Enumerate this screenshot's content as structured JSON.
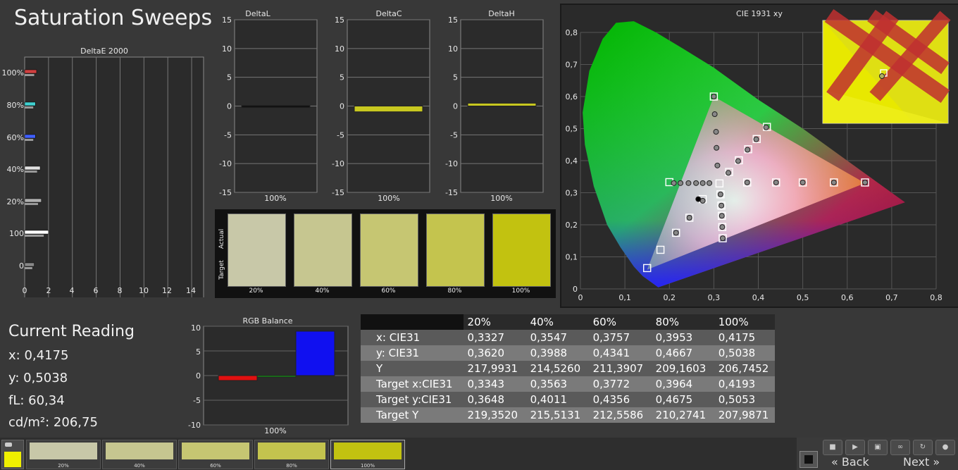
{
  "page_title": "Saturation Sweeps",
  "deltae": {
    "title": "DeltaE 2000",
    "xticks": [
      "0",
      "2",
      "4",
      "6",
      "8",
      "10",
      "12",
      "14"
    ],
    "ylabels": [
      "100%",
      "80%",
      "60%",
      "40%",
      "20%",
      "100",
      "0"
    ]
  },
  "delta_small": [
    {
      "title": "DeltaL",
      "xlabel": "100%"
    },
    {
      "title": "DeltaC",
      "xlabel": "100%"
    },
    {
      "title": "DeltaH",
      "xlabel": "100%"
    }
  ],
  "delta_yticks": [
    "15",
    "10",
    "5",
    "0",
    "-5",
    "-10",
    "-15"
  ],
  "swatch_panel": {
    "actual_label": "Actual",
    "target_label": "Target",
    "items": [
      {
        "label": "20%",
        "color": "#c8c8a8"
      },
      {
        "label": "40%",
        "color": "#c6c690"
      },
      {
        "label": "60%",
        "color": "#c6c672"
      },
      {
        "label": "80%",
        "color": "#c4c44e"
      },
      {
        "label": "100%",
        "color": "#c2c210"
      }
    ]
  },
  "cie": {
    "title": "CIE 1931 xy",
    "xticks": [
      "0",
      "0,1",
      "0,2",
      "0,3",
      "0,4",
      "0,5",
      "0,6",
      "0,7",
      "0,8"
    ],
    "yticks": [
      "0",
      "0,1",
      "0,2",
      "0,3",
      "0,4",
      "0,5",
      "0,6",
      "0,7",
      "0,8"
    ]
  },
  "current_reading": {
    "title": "Current Reading",
    "x": "x: 0,4175",
    "y": "y: 0,5038",
    "fl": "fL: 60,34",
    "cdm2": "cd/m²: 206,75"
  },
  "rgb_balance": {
    "title": "RGB Balance",
    "yticks": [
      "10",
      "5",
      "0",
      "-5",
      "-10"
    ],
    "xlabel": "100%"
  },
  "readings_table": {
    "headers": [
      "",
      "20%",
      "40%",
      "60%",
      "80%",
      "100%"
    ],
    "rows": [
      [
        "x: CIE31",
        "0,3327",
        "0,3547",
        "0,3757",
        "0,3953",
        "0,4175"
      ],
      [
        "y: CIE31",
        "0,3620",
        "0,3988",
        "0,4341",
        "0,4667",
        "0,5038"
      ],
      [
        "Y",
        "217,9931",
        "214,5260",
        "211,3907",
        "209,1603",
        "206,7452"
      ],
      [
        "Target x:CIE31",
        "0,3343",
        "0,3563",
        "0,3772",
        "0,3964",
        "0,4193"
      ],
      [
        "Target y:CIE31",
        "0,3648",
        "0,4011",
        "0,4356",
        "0,4675",
        "0,5053"
      ],
      [
        "Target Y",
        "219,3520",
        "215,5131",
        "212,5586",
        "210,2741",
        "207,9871"
      ]
    ]
  },
  "bottom_bar": {
    "swatches": [
      {
        "label": "20%",
        "color": "#c8c8a8"
      },
      {
        "label": "40%",
        "color": "#c6c690"
      },
      {
        "label": "60%",
        "color": "#c6c672"
      },
      {
        "label": "80%",
        "color": "#c4c44e"
      },
      {
        "label": "100%",
        "color": "#c2c210"
      }
    ],
    "back_label": "Back",
    "next_label": "Next"
  },
  "chart_data": [
    {
      "type": "bar",
      "title": "DeltaE 2000",
      "orientation": "horizontal",
      "categories": [
        "100%",
        "80%",
        "60%",
        "40%",
        "20%",
        "100",
        "0"
      ],
      "values": [
        1.0,
        0.9,
        0.9,
        1.3,
        1.4,
        2.0,
        0.8
      ],
      "xlim": [
        0,
        15
      ]
    },
    {
      "type": "bar",
      "title": "DeltaL",
      "categories": [
        "100%"
      ],
      "values": [
        0.1
      ],
      "ylim": [
        -15,
        15
      ]
    },
    {
      "type": "bar",
      "title": "DeltaC",
      "categories": [
        "100%"
      ],
      "values": [
        -1.0
      ],
      "ylim": [
        -15,
        15
      ]
    },
    {
      "type": "bar",
      "title": "DeltaH",
      "categories": [
        "100%"
      ],
      "values": [
        0.5
      ],
      "ylim": [
        -15,
        15
      ]
    },
    {
      "type": "bar",
      "title": "RGB Balance",
      "categories": [
        "100%"
      ],
      "series": [
        {
          "values": [
            -1.0
          ],
          "color": "#e01010"
        },
        {
          "values": [
            -0.2
          ],
          "color": "#10b010"
        },
        {
          "values": [
            9.0
          ],
          "color": "#1010f0"
        }
      ],
      "ylim": [
        -10,
        10
      ]
    },
    {
      "type": "scatter",
      "title": "CIE 1931 xy",
      "xlim": [
        0,
        0.8
      ],
      "ylim": [
        0,
        0.8
      ],
      "gamut_triangle": [
        [
          0.64,
          0.33
        ],
        [
          0.3,
          0.6
        ],
        [
          0.15,
          0.06
        ]
      ],
      "white_point": [
        0.3127,
        0.329
      ],
      "measured_sweep_yellow": {
        "x": [
          0.3327,
          0.3547,
          0.3757,
          0.3953,
          0.4175
        ],
        "y": [
          0.362,
          0.3988,
          0.4341,
          0.4667,
          0.5038
        ]
      },
      "target_sweep_yellow": {
        "x": [
          0.3343,
          0.3563,
          0.3772,
          0.3964,
          0.4193
        ],
        "y": [
          0.3648,
          0.4011,
          0.4356,
          0.4675,
          0.5053
        ]
      }
    }
  ]
}
